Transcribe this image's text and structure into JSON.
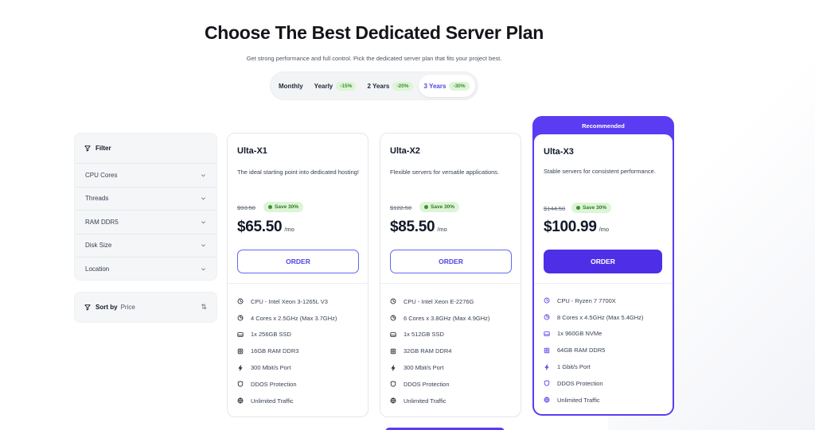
{
  "header": {
    "title": "Choose The Best Dedicated Server Plan",
    "subtitle": "Get strong performance and full control. Pick the dedicated server plan that fits your project best."
  },
  "periods": [
    {
      "label": "Monthly",
      "discount": ""
    },
    {
      "label": "Yearly",
      "discount": "-15%"
    },
    {
      "label": "2 Years",
      "discount": "-20%"
    },
    {
      "label": "3 Years",
      "discount": "-30%",
      "active": true
    }
  ],
  "filter": {
    "title": "Filter",
    "items": [
      "CPU Cores",
      "Threads",
      "RAM DDR5",
      "Disk Size",
      "Location"
    ]
  },
  "sort": {
    "label": "Sort by",
    "value": "Price"
  },
  "plans": [
    {
      "name": "Ulta-X1",
      "description": "The ideal starting point into dedicated hosting!",
      "old_price": "$93.50",
      "save": "Save 30%",
      "price": "$65.50",
      "period": "/mo",
      "order": "ORDER",
      "features": [
        "CPU - Intel Xeon 3-1265L V3",
        "4 Cores x 2.5GHz (Max 3.7GHz)",
        "1x 256GB SSD",
        "16GB RAM DDR3",
        "300 Mbit/s Port",
        "DDOS Protection",
        "Unlimited Traffic"
      ]
    },
    {
      "name": "Ulta-X2",
      "description": "Flexible servers for versatile applications.",
      "old_price": "$122.50",
      "save": "Save 30%",
      "price": "$85.50",
      "period": "/mo",
      "order": "ORDER",
      "features": [
        "CPU - Intel Xeon E-2276G",
        "6 Cores x 3.8GHz (Max 4.9GHz)",
        "1x 512GB SSD",
        "32GB RAM DDR4",
        "300 Mbit/s Port",
        "DDOS Protection",
        "Unlimited Traffic"
      ]
    },
    {
      "name": "Ulta-X3",
      "badge": "Recommended",
      "description": "Stable servers for consistent performance.",
      "old_price": "$144.50",
      "save": "Save 30%",
      "price": "$100.99",
      "period": "/mo",
      "order": "ORDER",
      "features": [
        "CPU - Ryzen 7 7700X",
        "8 Cores x 4.5GHz (Max 5.4GHz)",
        "1x 960GB NVMe",
        "64GB RAM DDR5",
        "1 Gbit/s Port",
        "DDOS Protection",
        "Unlimited Traffic"
      ]
    }
  ],
  "feature_icons": [
    "cpu-icon",
    "cores-icon",
    "disk-icon",
    "ram-icon",
    "port-icon",
    "shield-icon",
    "globe-icon"
  ],
  "colors": {
    "accent": "#4f2ee8",
    "recommended": "#5b3cf2",
    "save_bg": "#dcf5d6",
    "save_text": "#2f7a27"
  }
}
